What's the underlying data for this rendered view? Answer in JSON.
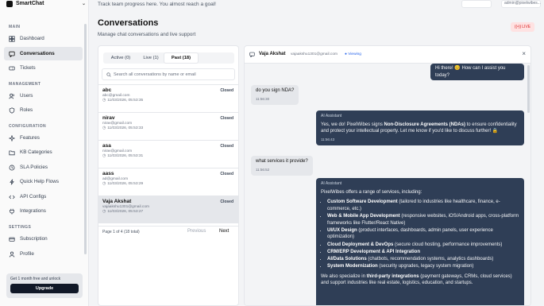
{
  "app": {
    "name": "SmartChat"
  },
  "topbar": {
    "message": "Track team progress here. You almost reach a goal!",
    "search_placeholder": "admin@pixelwibes..."
  },
  "sidebar": {
    "sections": [
      {
        "label": "MAIN",
        "items": [
          {
            "label": "Dashboard",
            "icon": "grid-icon"
          },
          {
            "label": "Conversations",
            "icon": "chat-icon",
            "active": true
          },
          {
            "label": "Tickets",
            "icon": "ticket-icon"
          }
        ]
      },
      {
        "label": "MANAGEMENT",
        "items": [
          {
            "label": "Users",
            "icon": "user-icon"
          },
          {
            "label": "Roles",
            "icon": "shield-icon"
          }
        ]
      },
      {
        "label": "CONFIGURATION",
        "items": [
          {
            "label": "Features",
            "icon": "sparkle-icon"
          },
          {
            "label": "KB Categories",
            "icon": "folder-icon"
          },
          {
            "label": "SLA Policies",
            "icon": "clock-icon"
          },
          {
            "label": "Quick Help Flows",
            "icon": "lightning-icon"
          },
          {
            "label": "API Configs",
            "icon": "code-icon"
          },
          {
            "label": "Integrations",
            "icon": "plug-icon"
          }
        ]
      },
      {
        "label": "SETTINGS",
        "items": [
          {
            "label": "Subscription",
            "icon": "card-icon"
          },
          {
            "label": "Profile",
            "icon": "person-icon"
          }
        ]
      }
    ],
    "upgrade": {
      "text": "Get 1 month free and unlock",
      "button": "Upgrade"
    }
  },
  "page": {
    "title": "Conversations",
    "subtitle": "Manage chat conversations and live support",
    "live_badge": "LIVE"
  },
  "list": {
    "tabs": [
      {
        "label": "Active (0)"
      },
      {
        "label": "Live (1)"
      },
      {
        "label": "Past (18)",
        "active": true
      }
    ],
    "search_placeholder": "Search all conversations by name or email",
    "items": [
      {
        "name": "abc",
        "email": "abc@gmail.com",
        "time": "11/03/2026, 05:53:35",
        "status": "Closed"
      },
      {
        "name": "nirav",
        "email": "nirav@gmail.com",
        "time": "11/03/2026, 05:53:33",
        "status": "Closed"
      },
      {
        "name": "asa",
        "email": "nirav@gmail.com",
        "time": "11/03/2026, 05:53:31",
        "status": "Closed"
      },
      {
        "name": "aass",
        "email": "ad@gmail.com",
        "time": "11/03/2026, 05:53:29",
        "status": "Closed"
      },
      {
        "name": "Vaja Akshat",
        "email": "vajaakshu1301@gmail.com",
        "time": "11/03/2026, 05:53:27",
        "status": "Closed",
        "selected": true
      }
    ],
    "pager": {
      "info": "Page 1 of 4 (18 total)",
      "prev": "Previous",
      "next": "Next"
    }
  },
  "chat": {
    "name": "Vaja Akshat",
    "email": "vajaakshu1301@gmail.com",
    "viewing": "● Viewing",
    "close": "×",
    "greeting": "Hi there! 😊 How can I assist you today?",
    "q1": {
      "text": "do you sign NDA?",
      "time": "11:56:30"
    },
    "a1": {
      "label": "AI Assistant",
      "pre": "Yes, we do! PixelWibes signs ",
      "bold": "Non-Disclosure Agreements (NDAs)",
      "post": " to ensure confidentiality and protect your intellectual property. Let me know if you'd like to discuss further! 🔒",
      "time": "11:56:43"
    },
    "q2": {
      "text": "what services it provide?",
      "time": "11:56:52"
    },
    "a2": {
      "label": "AI Assistant",
      "intro": "PixelWibes offers a range of services, including:",
      "bullets": [
        {
          "b": "Custom Software Development",
          "t": " (tailored to industries like healthcare, finance, e-commerce, etc.)"
        },
        {
          "b": "Web & Mobile App Development",
          "t": " (responsive websites, iOS/Android apps, cross-platform frameworks like Flutter/React Native)"
        },
        {
          "b": "UI/UX Design",
          "t": " (product interfaces, dashboards, admin panels, user experience optimization)"
        },
        {
          "b": "Cloud Deployment & DevOps",
          "t": " (secure cloud hosting, performance improvements)"
        },
        {
          "b": "CRM/ERP Development & API Integration",
          "t": ""
        },
        {
          "b": "AI/Data Solutions",
          "t": " (chatbots, recommendation systems, analytics dashboards)"
        },
        {
          "b": "System Modernization",
          "t": " (security upgrades, legacy system migration)"
        }
      ],
      "outro_pre": "We also specialize in ",
      "outro_bold": "third-party integrations",
      "outro_post": " (payment gateways, CRMs, cloud services) and support industries like real estate, logistics, education, and startups."
    }
  }
}
